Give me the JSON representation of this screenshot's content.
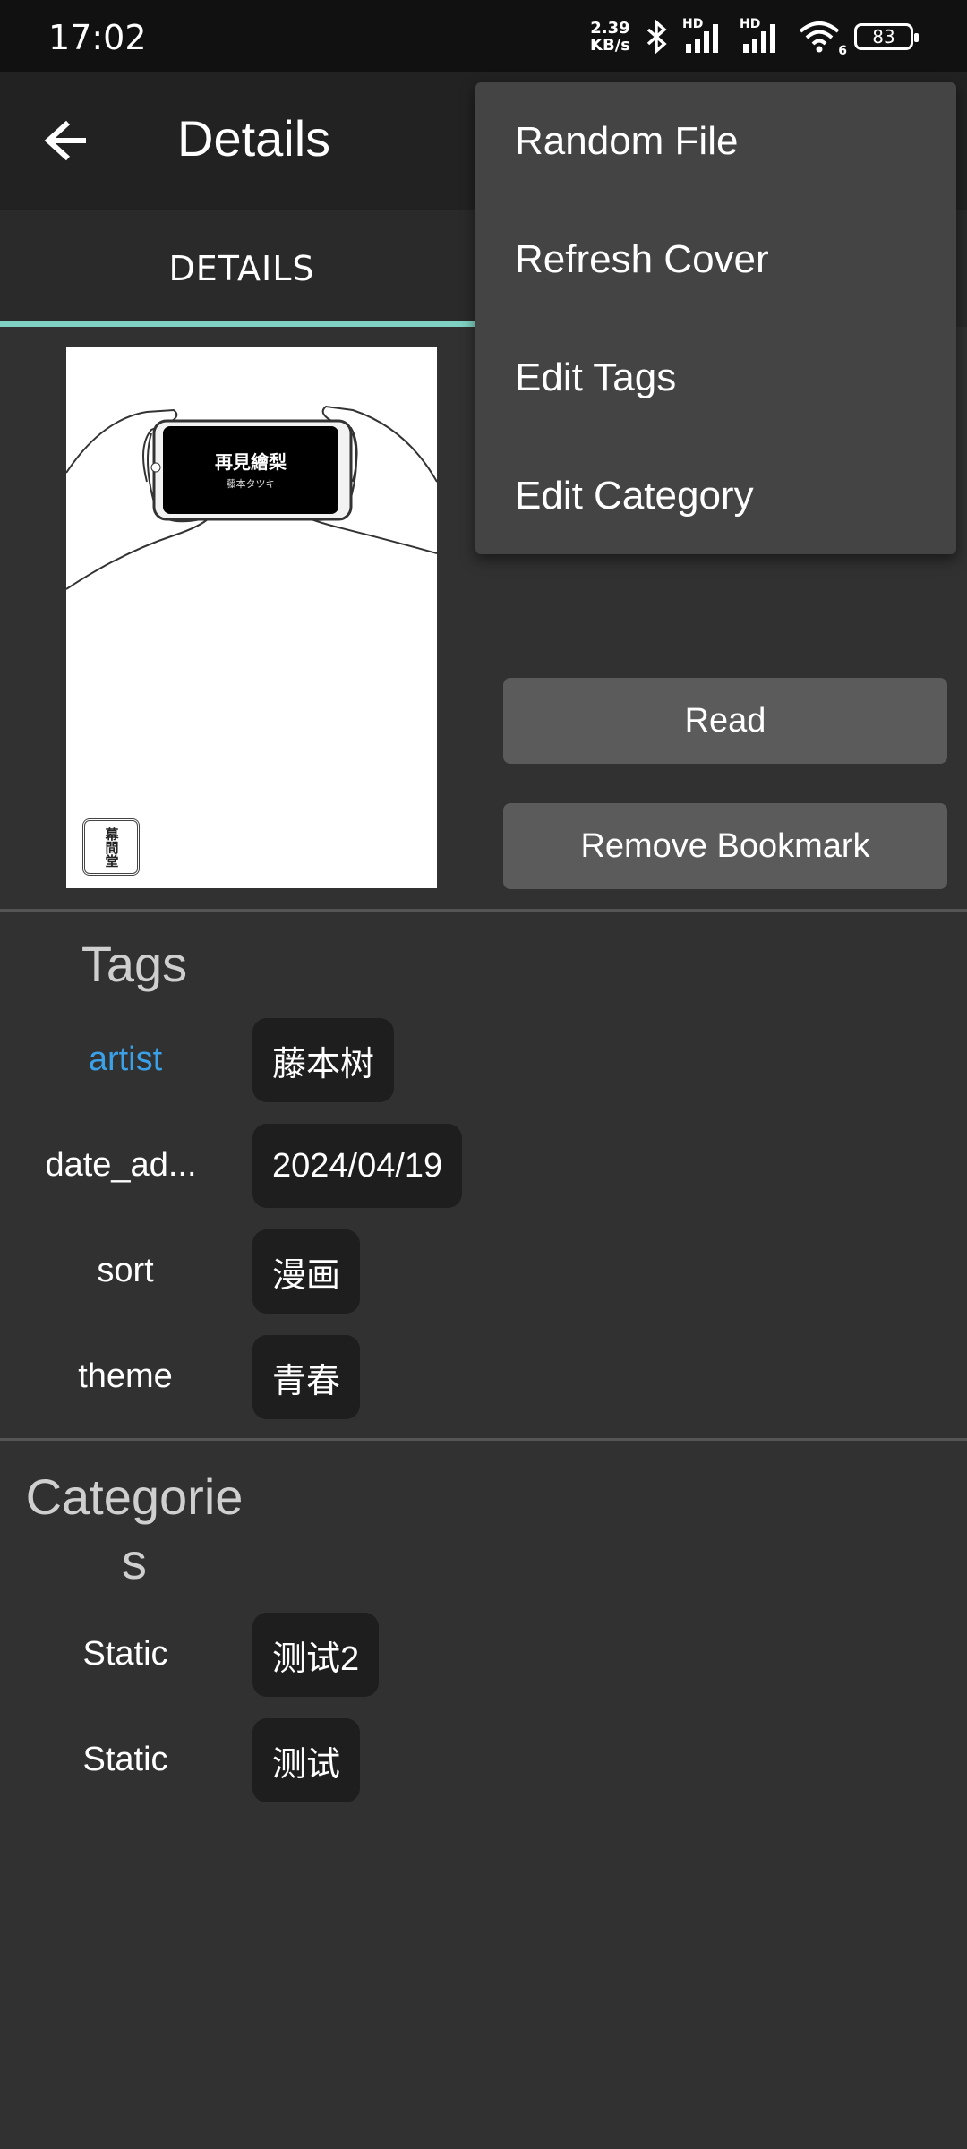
{
  "status_bar": {
    "time": "17:02",
    "net_speed_value": "2.39",
    "net_speed_unit": "KB/s",
    "signal1_label": "HD",
    "signal2_label": "HD",
    "wifi_label": "6",
    "battery": "83"
  },
  "app_bar": {
    "title": "Details"
  },
  "tabs": {
    "details_label": "DETAILS"
  },
  "cover": {
    "title": "再見繪梨",
    "author": "藤本タツキ",
    "seal": "幕間堂"
  },
  "actions": {
    "read_label": "Read",
    "remove_bookmark_label": "Remove Bookmark"
  },
  "tags": {
    "heading": "Tags",
    "items": [
      {
        "label": "artist",
        "value": "藤本树"
      },
      {
        "label": "date_ad...",
        "value": "2024/04/19"
      },
      {
        "label": "sort",
        "value": "漫画"
      },
      {
        "label": "theme",
        "value": "青春"
      }
    ]
  },
  "categories": {
    "heading_line1": "Categorie",
    "heading_line2": "s",
    "items": [
      {
        "label": "Static",
        "value": "测试2"
      },
      {
        "label": "Static",
        "value": "测试"
      }
    ]
  },
  "overflow_menu": {
    "items": [
      "Random File",
      "Refresh Cover",
      "Edit Tags",
      "Edit Category"
    ]
  },
  "colors": {
    "accent": "#7fd2c3",
    "link": "#3aa0e8",
    "background": "#313131"
  }
}
